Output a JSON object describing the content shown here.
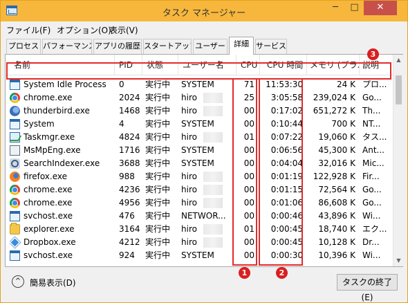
{
  "window": {
    "title": "タスク マネージャー",
    "minimize": "─",
    "maximize": "□",
    "close": "✕"
  },
  "menu": {
    "items": [
      "ファイル(F)",
      "オプション(O)",
      "表示(V)"
    ]
  },
  "tabs": {
    "items": [
      "プロセス",
      "パフォーマンス",
      "アプリの履歴",
      "スタートアップ",
      "ユーザー",
      "詳細",
      "サービス"
    ],
    "active": "詳細"
  },
  "table": {
    "columns": {
      "name": "名前",
      "pid": "PID",
      "state": "状態",
      "user": "ユーザー名",
      "cpu": "CPU",
      "cpu_time": "CPU 時間",
      "memory": "メモリ (プラ...",
      "desc": "説明"
    },
    "rows": [
      {
        "icon": "window-icon",
        "name": "System Idle Process",
        "pid": "0",
        "state": "実行中",
        "user": "SYSTEM",
        "cpu": "71",
        "time": "11:53:30",
        "mem": "24 K",
        "desc": "プロ..."
      },
      {
        "icon": "chrome-icon",
        "name": "chrome.exe",
        "pid": "2024",
        "state": "実行中",
        "user": "hiro",
        "cpu": "25",
        "time": "3:05:58",
        "mem": "239,024 K",
        "desc": "Go..."
      },
      {
        "icon": "thunderbird-icon",
        "name": "thunderbird.exe",
        "pid": "1468",
        "state": "実行中",
        "user": "hiro",
        "cpu": "00",
        "time": "0:17:02",
        "mem": "651,272 K",
        "desc": "Th..."
      },
      {
        "icon": "window-icon",
        "name": "System",
        "pid": "4",
        "state": "実行中",
        "user": "SYSTEM",
        "cpu": "00",
        "time": "0:10:44",
        "mem": "700 K",
        "desc": "NT..."
      },
      {
        "icon": "taskmgr-icon",
        "name": "Taskmgr.exe",
        "pid": "4824",
        "state": "実行中",
        "user": "hiro",
        "cpu": "01",
        "time": "0:07:22",
        "mem": "19,060 K",
        "desc": "タス..."
      },
      {
        "icon": "mpeng-icon",
        "name": "MsMpEng.exe",
        "pid": "1716",
        "state": "実行中",
        "user": "SYSTEM",
        "cpu": "00",
        "time": "0:06:56",
        "mem": "45,300 K",
        "desc": "Ant..."
      },
      {
        "icon": "searchindexer-icon",
        "name": "SearchIndexer.exe",
        "pid": "3688",
        "state": "実行中",
        "user": "SYSTEM",
        "cpu": "00",
        "time": "0:04:04",
        "mem": "32,016 K",
        "desc": "Mic..."
      },
      {
        "icon": "firefox-icon",
        "name": "firefox.exe",
        "pid": "988",
        "state": "実行中",
        "user": "hiro",
        "cpu": "00",
        "time": "0:01:19",
        "mem": "122,928 K",
        "desc": "Fir..."
      },
      {
        "icon": "chrome-icon",
        "name": "chrome.exe",
        "pid": "4236",
        "state": "実行中",
        "user": "hiro",
        "cpu": "00",
        "time": "0:01:15",
        "mem": "72,564 K",
        "desc": "Go..."
      },
      {
        "icon": "chrome-icon",
        "name": "chrome.exe",
        "pid": "4956",
        "state": "実行中",
        "user": "hiro",
        "cpu": "00",
        "time": "0:01:06",
        "mem": "86,608 K",
        "desc": "Go..."
      },
      {
        "icon": "window-icon",
        "name": "svchost.exe",
        "pid": "476",
        "state": "実行中",
        "user": "NETWOR...",
        "cpu": "00",
        "time": "0:00:46",
        "mem": "43,896 K",
        "desc": "Wi..."
      },
      {
        "icon": "explorer-icon",
        "name": "explorer.exe",
        "pid": "3164",
        "state": "実行中",
        "user": "hiro",
        "cpu": "01",
        "time": "0:00:45",
        "mem": "18,740 K",
        "desc": "エク..."
      },
      {
        "icon": "dropbox-icon",
        "name": "Dropbox.exe",
        "pid": "4212",
        "state": "実行中",
        "user": "hiro",
        "cpu": "00",
        "time": "0:00:45",
        "mem": "10,128 K",
        "desc": "Dr..."
      },
      {
        "icon": "window-icon",
        "name": "svchost.exe",
        "pid": "924",
        "state": "実行中",
        "user": "SYSTEM",
        "cpu": "00",
        "time": "0:00:30",
        "mem": "10,396 K",
        "desc": "Wi..."
      }
    ]
  },
  "annotations": {
    "marker1": "1",
    "marker2": "2",
    "marker3": "3"
  },
  "footer": {
    "fewer_details": "簡易表示(D)",
    "end_task": "タスクの終了(E)"
  }
}
